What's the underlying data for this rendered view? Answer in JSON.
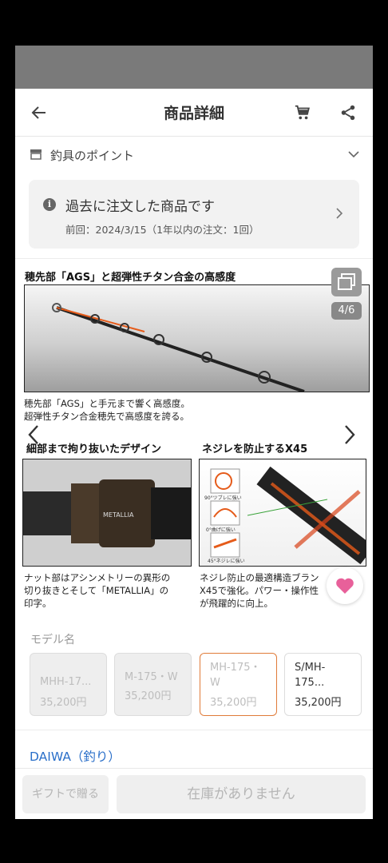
{
  "header": {
    "title": "商品詳細"
  },
  "points": {
    "label": "釣具のポイント"
  },
  "order_history": {
    "title": "過去に注文した商品です",
    "detail": "前回：2024/3/15（1年以内の注文：1回）"
  },
  "gallery": {
    "counter": "4/6",
    "panel1": {
      "caption": "穂先部「AGS」と超弾性チタン合金の高感度",
      "desc_line1": "穂先部「AGS」と手元まで響く高感度。",
      "desc_line2": "超弾性チタン合金穂先で高感度を誇る。"
    },
    "panel2": {
      "caption": "細部まで拘り抜いたデザイン",
      "reel_text": "METALLIA",
      "desc_line1": "ナット部はアシンメトリーの異形の",
      "desc_line2": "切り抜きとそして「METALLIA」の",
      "desc_line3": "印字。"
    },
    "panel3": {
      "caption": "ネジレを防止するX45",
      "label_a": "90°ツブレに強い",
      "label_b": "0°曲げに強い",
      "label_c": "45°ネジレに強い",
      "desc_line1": "ネジレ防止の最適構造ブラン",
      "desc_line2": "X45で強化。パワー・操作性",
      "desc_line3": "が飛躍的に向上。"
    }
  },
  "models": {
    "label": "モデル名",
    "items": [
      {
        "name": "MHH-17...",
        "price": "35,200円",
        "state": "disabled"
      },
      {
        "name": "M-175・W",
        "price": "35,200円",
        "state": "disabled"
      },
      {
        "name": "MH-175・W",
        "price": "35,200円",
        "state": "selected"
      },
      {
        "name": "S/MH-175...",
        "price": "35,200円",
        "state": "normal"
      }
    ]
  },
  "brand": {
    "label": "DAIWA（釣り）"
  },
  "actions": {
    "gift": "ギフトで贈る",
    "buy": "在庫がありません"
  },
  "colors": {
    "accent": "#e07b39",
    "link": "#2a6fc9",
    "favorite": "#e8609a"
  }
}
